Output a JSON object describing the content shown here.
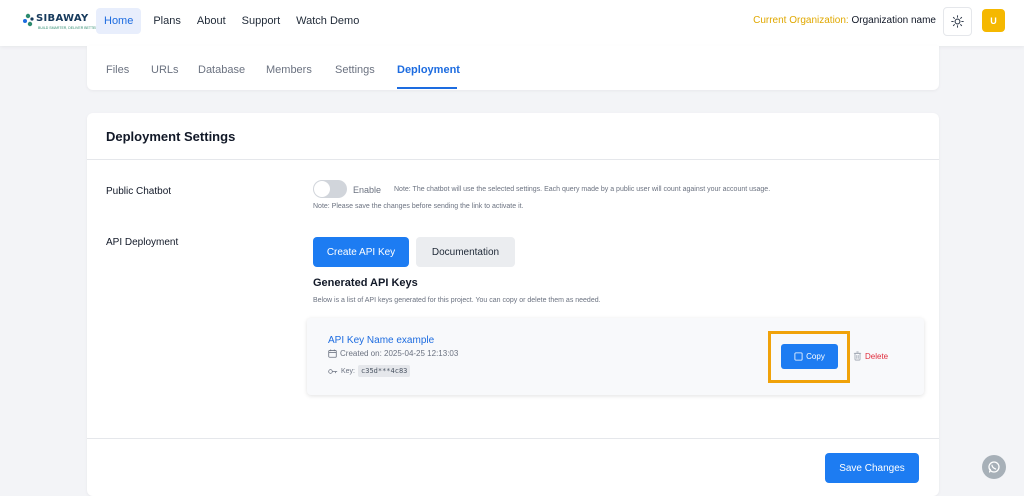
{
  "brand": {
    "name": "SIBAWAY",
    "tagline": "BUILD SMARTER, DELIVER BETTER",
    "accent": "#1d7cf2",
    "highlight": "#f0a20a"
  },
  "nav": {
    "items": [
      "Home",
      "Plans",
      "About",
      "Support",
      "Watch Demo"
    ]
  },
  "header": {
    "org_label": "Current Organization:",
    "org_value": "Organization name",
    "avatar_letter": "U"
  },
  "tabs": [
    "Files",
    "URLs",
    "Database",
    "Members",
    "Settings",
    "Deployment"
  ],
  "settings": {
    "title": "Deployment Settings",
    "public_chatbot": {
      "label": "Public Chatbot",
      "toggle_label": "Enable",
      "enabled": false,
      "note": "Note: The chatbot will use the selected settings. Each query made by a public user will count against your account usage.",
      "save_note": "Note: Please save the changes before sending the link to activate it."
    },
    "api": {
      "label": "API Deployment",
      "create_button": "Create API Key",
      "docs_button": "Documentation",
      "generated_title": "Generated API Keys",
      "generated_desc": "Below is a list of API keys generated for this project. You can copy or delete them as needed.",
      "keys": [
        {
          "name": "API Key Name example",
          "created": "Created on: 2025-04-25 12:13:03",
          "key_label": "Key:",
          "key_value": "c35d***4c83",
          "copy_label": "Copy",
          "delete_label": "Delete"
        }
      ]
    },
    "save_button": "Save Changes"
  }
}
